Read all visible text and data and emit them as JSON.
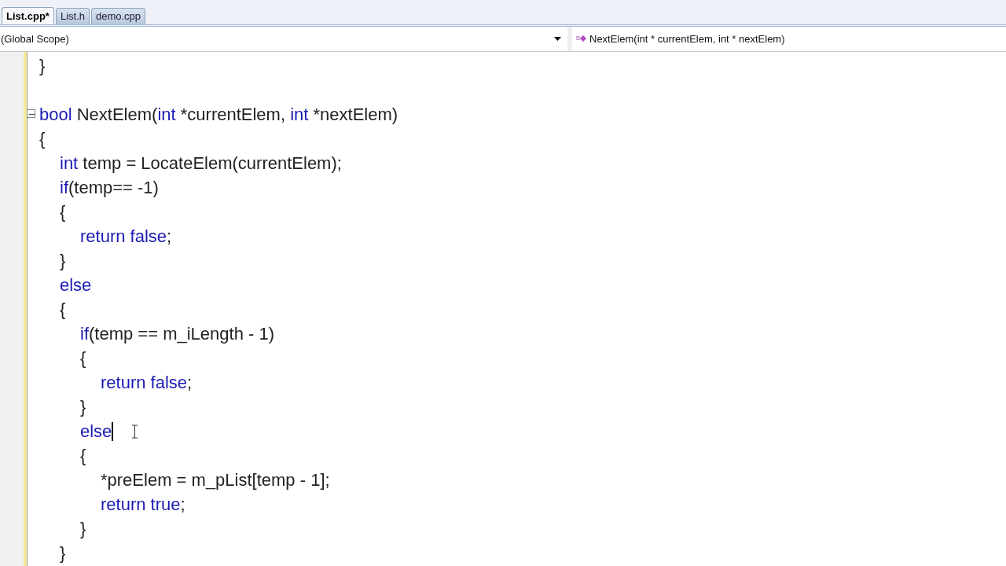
{
  "tabs": [
    {
      "label": "List.cpp*",
      "selected": true
    },
    {
      "label": "List.h",
      "selected": false
    },
    {
      "label": "demo.cpp",
      "selected": false
    }
  ],
  "scope_dropdown": {
    "value": "(Global Scope)"
  },
  "member_dropdown": {
    "value": "NextElem(int * currentElem, int * nextElem)"
  },
  "code_lines": [
    {
      "kind": "code",
      "tokens": [
        {
          "kind": "plain",
          "text": "}"
        }
      ]
    },
    {
      "kind": "blank"
    },
    {
      "kind": "code",
      "outline": {
        "expanded": true
      },
      "tokens": [
        {
          "kind": "keyword",
          "text": "bool"
        },
        {
          "kind": "plain",
          "text": " NextElem("
        },
        {
          "kind": "keyword",
          "text": "int"
        },
        {
          "kind": "plain",
          "text": " *currentElem, "
        },
        {
          "kind": "keyword",
          "text": "int"
        },
        {
          "kind": "plain",
          "text": " *nextElem)"
        }
      ]
    },
    {
      "kind": "code",
      "tokens": [
        {
          "kind": "plain",
          "text": "{"
        }
      ],
      "children": [
        {
          "kind": "code",
          "tokens": [
            {
              "kind": "keyword",
              "text": "int"
            },
            {
              "kind": "plain",
              "text": " temp = LocateElem(currentElem);"
            }
          ]
        },
        {
          "kind": "code",
          "tokens": [
            {
              "kind": "keyword",
              "text": "if"
            },
            {
              "kind": "plain",
              "text": "(temp== -1)"
            }
          ]
        },
        {
          "kind": "code",
          "tokens": [
            {
              "kind": "plain",
              "text": "{"
            }
          ],
          "children": [
            {
              "kind": "code",
              "tokens": [
                {
                  "kind": "keyword",
                  "text": "return false"
                },
                {
                  "kind": "plain",
                  "text": ";"
                }
              ]
            }
          ]
        },
        {
          "kind": "code",
          "tokens": [
            {
              "kind": "plain",
              "text": "}"
            }
          ]
        },
        {
          "kind": "code",
          "tokens": [
            {
              "kind": "keyword",
              "text": "else"
            }
          ]
        },
        {
          "kind": "code",
          "tokens": [
            {
              "kind": "plain",
              "text": "{"
            }
          ],
          "children": [
            {
              "kind": "code",
              "tokens": [
                {
                  "kind": "keyword",
                  "text": "if"
                },
                {
                  "kind": "plain",
                  "text": "(temp == m_iLength - 1)"
                }
              ]
            },
            {
              "kind": "code",
              "tokens": [
                {
                  "kind": "plain",
                  "text": "{"
                }
              ],
              "children": [
                {
                  "kind": "code",
                  "tokens": [
                    {
                      "kind": "keyword",
                      "text": "return false"
                    },
                    {
                      "kind": "plain",
                      "text": ";"
                    }
                  ]
                }
              ]
            },
            {
              "kind": "code",
              "tokens": [
                {
                  "kind": "plain",
                  "text": "}"
                }
              ]
            },
            {
              "kind": "code",
              "caret": true,
              "tokens": [
                {
                  "kind": "keyword",
                  "text": "else"
                }
              ]
            },
            {
              "kind": "code",
              "tokens": [
                {
                  "kind": "plain",
                  "text": "{"
                }
              ],
              "children": [
                {
                  "kind": "code",
                  "tokens": [
                    {
                      "kind": "plain",
                      "text": "*preElem = m_pList[temp - 1];"
                    }
                  ]
                },
                {
                  "kind": "code",
                  "tokens": [
                    {
                      "kind": "keyword",
                      "text": "return true"
                    },
                    {
                      "kind": "plain",
                      "text": ";"
                    }
                  ]
                }
              ]
            },
            {
              "kind": "code",
              "tokens": [
                {
                  "kind": "plain",
                  "text": "}"
                }
              ]
            }
          ]
        },
        {
          "kind": "code",
          "tokens": [
            {
              "kind": "plain",
              "text": "}"
            }
          ]
        }
      ]
    }
  ]
}
